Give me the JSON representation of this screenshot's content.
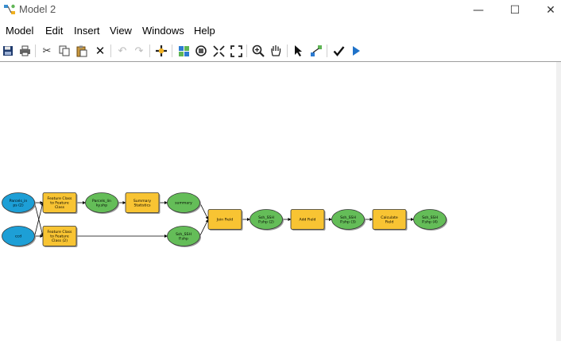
{
  "window": {
    "title": "Model 2",
    "icon": "model-diagram-icon",
    "controls": {
      "minimize": "—",
      "maximize": "☐",
      "close": "✕"
    }
  },
  "menu": [
    "Model",
    "Edit",
    "Insert",
    "View",
    "Windows",
    "Help"
  ],
  "toolbar": [
    "save-icon",
    "print-icon",
    "cut-icon",
    "copy-icon",
    "paste-icon",
    "delete-icon",
    "undo-icon",
    "redo-icon",
    "add-data-icon",
    "auto-layout-icon",
    "full-extent-icon",
    "fixed-zoom-in-icon",
    "fixed-zoom-out-icon",
    "zoom-in-icon",
    "pan-icon",
    "select-icon",
    "connect-icon",
    "validate-icon",
    "run-icon"
  ],
  "colors": {
    "input_data": "#1d9fd6",
    "derived_data": "#64bd58",
    "tool": "#f8c433",
    "node_outline": "#333333"
  },
  "diagram": {
    "nodes": {
      "parcels_in": {
        "kind": "input_data",
        "lines": [
          "Parcels_in",
          "ps (2)"
        ]
      },
      "ccd": {
        "kind": "input_data",
        "lines": [
          "ccd"
        ]
      },
      "fc_to_fc": {
        "kind": "tool",
        "lines": [
          "Feature Class",
          "to Feature",
          "Class"
        ]
      },
      "fc_to_fc_2": {
        "kind": "tool",
        "lines": [
          "Feature Class",
          "to Feature",
          "Class (2)"
        ]
      },
      "parcels_shp": {
        "kind": "derived_data",
        "lines": [
          "Parcels_lin",
          "ky.shp"
        ]
      },
      "summary_stats": {
        "kind": "tool",
        "lines": [
          "Summary",
          "Statistics"
        ]
      },
      "summary": {
        "kind": "derived_data",
        "lines": [
          "summary"
        ]
      },
      "ssh_shp": {
        "kind": "derived_data",
        "lines": [
          "Ssh_SSH",
          "P.shp"
        ]
      },
      "join_field": {
        "kind": "tool",
        "lines": [
          "Join Field"
        ]
      },
      "ssh_shp_2": {
        "kind": "derived_data",
        "lines": [
          "Ssh_SSH",
          "P.shp (2)"
        ]
      },
      "add_field": {
        "kind": "tool",
        "lines": [
          "Add Field"
        ]
      },
      "ssh_shp_3": {
        "kind": "derived_data",
        "lines": [
          "Ssh_SSH",
          "P.shp (3)"
        ]
      },
      "calc_field": {
        "kind": "tool",
        "lines": [
          "Calculate",
          "Field"
        ]
      },
      "ssh_shp_4": {
        "kind": "derived_data",
        "lines": [
          "Ssh_SSH",
          "P.shp (4)"
        ]
      }
    },
    "connections": [
      [
        "parcels_in",
        "fc_to_fc"
      ],
      [
        "ccd",
        "fc_to_fc"
      ],
      [
        "parcels_in",
        "fc_to_fc_2"
      ],
      [
        "ccd",
        "fc_to_fc_2"
      ],
      [
        "fc_to_fc",
        "parcels_shp"
      ],
      [
        "parcels_shp",
        "summary_stats"
      ],
      [
        "summary_stats",
        "summary"
      ],
      [
        "fc_to_fc_2",
        "ssh_shp"
      ],
      [
        "summary",
        "join_field"
      ],
      [
        "ssh_shp",
        "join_field"
      ],
      [
        "join_field",
        "ssh_shp_2"
      ],
      [
        "ssh_shp_2",
        "add_field"
      ],
      [
        "add_field",
        "ssh_shp_3"
      ],
      [
        "ssh_shp_3",
        "calc_field"
      ],
      [
        "calc_field",
        "ssh_shp_4"
      ]
    ]
  }
}
